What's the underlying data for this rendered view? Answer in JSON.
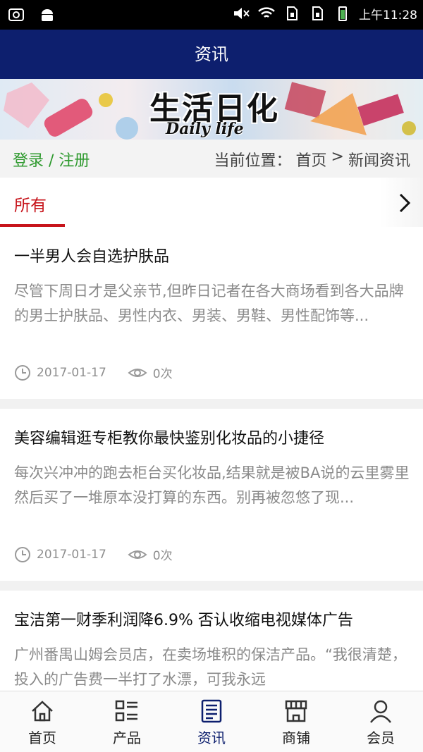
{
  "status_bar": {
    "time": "上午11:28",
    "icons": [
      "screenshot-icon",
      "android-icon",
      "mute-icon",
      "wifi-icon",
      "sim1-icon",
      "sim2-icon",
      "battery-icon"
    ]
  },
  "header": {
    "title": "资讯",
    "color": "#0d1f6e"
  },
  "banner": {
    "title": "生活日化",
    "subtitle": "Daily life"
  },
  "location_bar": {
    "login": "登录 / 注册",
    "current": "当前位置：",
    "crumb_home": "首页",
    "separator": ">",
    "crumb_current": "新闻资讯"
  },
  "tabs": {
    "active_label": "所有",
    "accent_color": "#c7141b",
    "more_icon": "chevron-right-icon"
  },
  "articles": [
    {
      "title": "一半男人会自选护肤品",
      "summary": "尽管下周日才是父亲节,但昨日记者在各大商场看到各大品牌的男士护肤品、男性内衣、男装、男鞋、男性配饰等...",
      "date": "2017-01-17",
      "views": "0次"
    },
    {
      "title": "美容编辑逛专柜教你最快鉴别化妆品的小捷径",
      "summary": "每次兴冲冲的跑去柜台买化妆品,结果就是被BA说的云里雾里然后买了一堆原本没打算的东西。别再被忽悠了现...",
      "date": "2017-01-17",
      "views": "0次"
    },
    {
      "title": "宝洁第一财季利润降6.9% 否认收缩电视媒体广告",
      "summary": "广州番禺山姆会员店，在卖场堆积的保洁产品。“我很清楚，投入的广告费一半打了水漂，可我永远",
      "date": "",
      "views": ""
    }
  ],
  "bottom_nav": {
    "items": [
      {
        "label": "首页",
        "icon": "home-icon"
      },
      {
        "label": "产品",
        "icon": "grid-list-icon"
      },
      {
        "label": "资讯",
        "icon": "news-icon",
        "active": true
      },
      {
        "label": "商铺",
        "icon": "shop-icon"
      },
      {
        "label": "会员",
        "icon": "user-icon"
      }
    ]
  }
}
